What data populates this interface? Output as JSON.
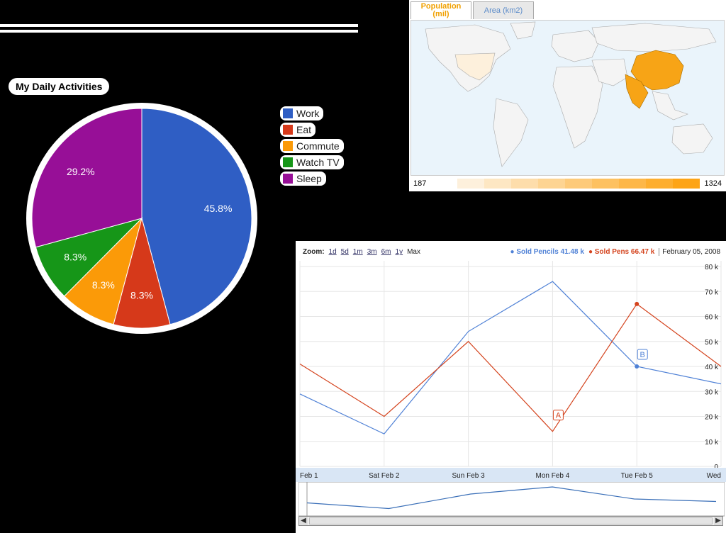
{
  "chart_data": [
    {
      "type": "pie",
      "title": "My Daily Activities",
      "categories": [
        "Work",
        "Eat",
        "Commute",
        "Watch TV",
        "Sleep"
      ],
      "values": [
        45.8,
        8.3,
        8.3,
        8.3,
        29.2
      ],
      "labels": [
        "45.8%",
        "8.3%",
        "8.3%",
        "8.3%",
        "29.2%"
      ],
      "colors": [
        "#2f5ec4",
        "#d6391a",
        "#fb9a08",
        "#169618",
        "#970f97"
      ],
      "legend": "right"
    },
    {
      "type": "map",
      "tabs": [
        "Population\n(mil)",
        "Area (km2)"
      ],
      "active_tab": "Population (mil)",
      "scale_min": "187",
      "scale_max": "1324",
      "highlighted": [
        "China",
        "India",
        "United States"
      ],
      "colors": [
        "#fdf3e3",
        "#f7a416"
      ]
    },
    {
      "type": "line",
      "zoom_label": "Zoom:",
      "zoom_options": [
        "1d",
        "5d",
        "1m",
        "3m",
        "6m",
        "1y",
        "Max"
      ],
      "categories": [
        "Feb 1",
        "Sat Feb 2",
        "Sun Feb 3",
        "Mon Feb 4",
        "Tue Feb 5",
        "Wed"
      ],
      "series": [
        {
          "name": "Sold Pencils",
          "color": "#4f81d6",
          "current": "41.48 k",
          "values": [
            29,
            13,
            54,
            74,
            40,
            33
          ]
        },
        {
          "name": "Sold Pens",
          "color": "#d4431d",
          "current": "66.47 k",
          "values": [
            41,
            20,
            50,
            14,
            65,
            40
          ]
        }
      ],
      "date_label": "February 05, 2008",
      "yticks": [
        "0",
        "10 k",
        "20 k",
        "30 k",
        "40 k",
        "50 k",
        "60 k",
        "70 k",
        "80 k"
      ],
      "ylim": [
        0,
        80
      ],
      "annotations": [
        {
          "label": "A"
        },
        {
          "label": "B"
        }
      ]
    }
  ]
}
